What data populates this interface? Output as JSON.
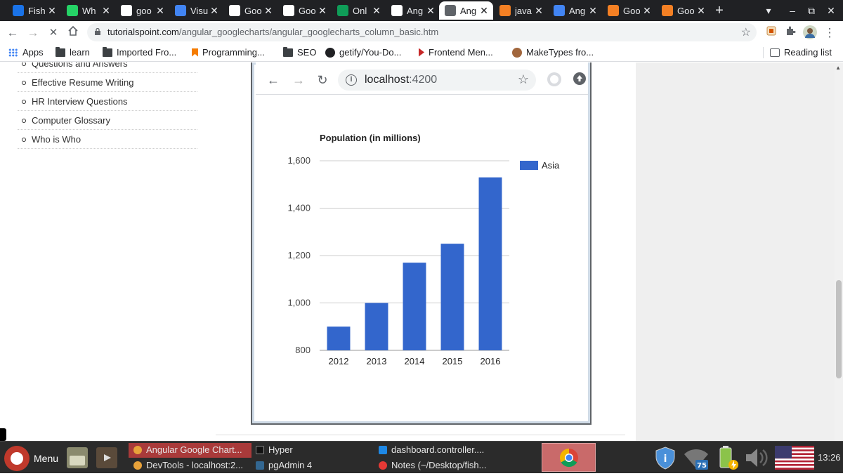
{
  "tabs": [
    {
      "label": "Fish",
      "icon": "devtools-icon",
      "color": "#1a73e8"
    },
    {
      "label": "Wh",
      "icon": "whatsapp-icon",
      "color": "#25d366"
    },
    {
      "label": "goo",
      "icon": "google-icon",
      "color": "#ffffff"
    },
    {
      "label": "Visu",
      "icon": "visual-studio-icon",
      "color": "#4285f4"
    },
    {
      "label": "Goo",
      "icon": "openai-icon",
      "color": "#ffffff"
    },
    {
      "label": "Goo",
      "icon": "openai-icon",
      "color": "#ffffff"
    },
    {
      "label": "Onl",
      "icon": "code-icon",
      "color": "#0f9d58"
    },
    {
      "label": "Ang",
      "icon": "openai-icon",
      "color": "#ffffff"
    },
    {
      "label": "Ang",
      "icon": "tutorialspoint-icon",
      "color": "#5f6368",
      "active": true
    },
    {
      "label": "java",
      "icon": "stackoverflow-icon",
      "color": "#f48024"
    },
    {
      "label": "Ang",
      "icon": "visual-studio-icon",
      "color": "#4285f4"
    },
    {
      "label": "Goo",
      "icon": "stackoverflow-icon",
      "color": "#f48024"
    },
    {
      "label": "Goo",
      "icon": "stackoverflow-icon",
      "color": "#f48024"
    }
  ],
  "toolbar": {
    "url_host": "tutorialspoint.com",
    "url_path": "/angular_googlecharts/angular_googlecharts_column_basic.htm"
  },
  "bookmarks": [
    {
      "label": "Apps",
      "icon": "apps-grid-icon"
    },
    {
      "label": "learn",
      "icon": "folder-icon"
    },
    {
      "label": "Imported Fro...",
      "icon": "folder-icon"
    },
    {
      "label": "Programming...",
      "icon": "bookmark-icon"
    },
    {
      "label": "SEO",
      "icon": "folder-icon"
    },
    {
      "label": "getify/You-Do...",
      "icon": "github-icon"
    },
    {
      "label": "Frontend Men...",
      "icon": "frontend-masters-icon"
    },
    {
      "label": "MakeTypes fro...",
      "icon": "avatar-icon"
    }
  ],
  "reading_list": "Reading list",
  "sidebar": {
    "items": [
      {
        "label": "Questions and Answers"
      },
      {
        "label": "Effective Resume Writing"
      },
      {
        "label": "HR Interview Questions"
      },
      {
        "label": "Computer Glossary"
      },
      {
        "label": "Who is Who"
      }
    ]
  },
  "embed": {
    "url_host": "localhost",
    "url_port": ":4200"
  },
  "chart_data": {
    "type": "bar",
    "title": "Population (in millions)",
    "categories": [
      "2012",
      "2013",
      "2014",
      "2015",
      "2016"
    ],
    "series": [
      {
        "name": "Asia",
        "values": [
          900,
          1000,
          1170,
          1250,
          1530
        ],
        "color": "#3366cc"
      }
    ],
    "ylim": [
      800,
      1600
    ],
    "yticks": [
      800,
      1000,
      1200,
      1400,
      1600
    ],
    "ytick_labels": [
      "800",
      "1,000",
      "1,200",
      "1,400",
      "1,600"
    ],
    "xlabel": "",
    "ylabel": "",
    "grid": true,
    "legend_position": "right"
  },
  "taskbar": {
    "menu_label": "Menu",
    "tasks": [
      {
        "label": "Angular Google Chart...",
        "icon": "chrome-icon"
      },
      {
        "label": "DevTools - localhost:2...",
        "icon": "chrome-icon"
      },
      {
        "label": "Hyper",
        "icon": "terminal-icon"
      },
      {
        "label": "pgAdmin 4",
        "icon": "pgadmin-icon"
      },
      {
        "label": "dashboard.controller....",
        "icon": "vscode-icon"
      },
      {
        "label": "Notes (~/Desktop/fish...",
        "icon": "notes-icon"
      }
    ],
    "battery_level": "75",
    "clock": "13:26"
  }
}
